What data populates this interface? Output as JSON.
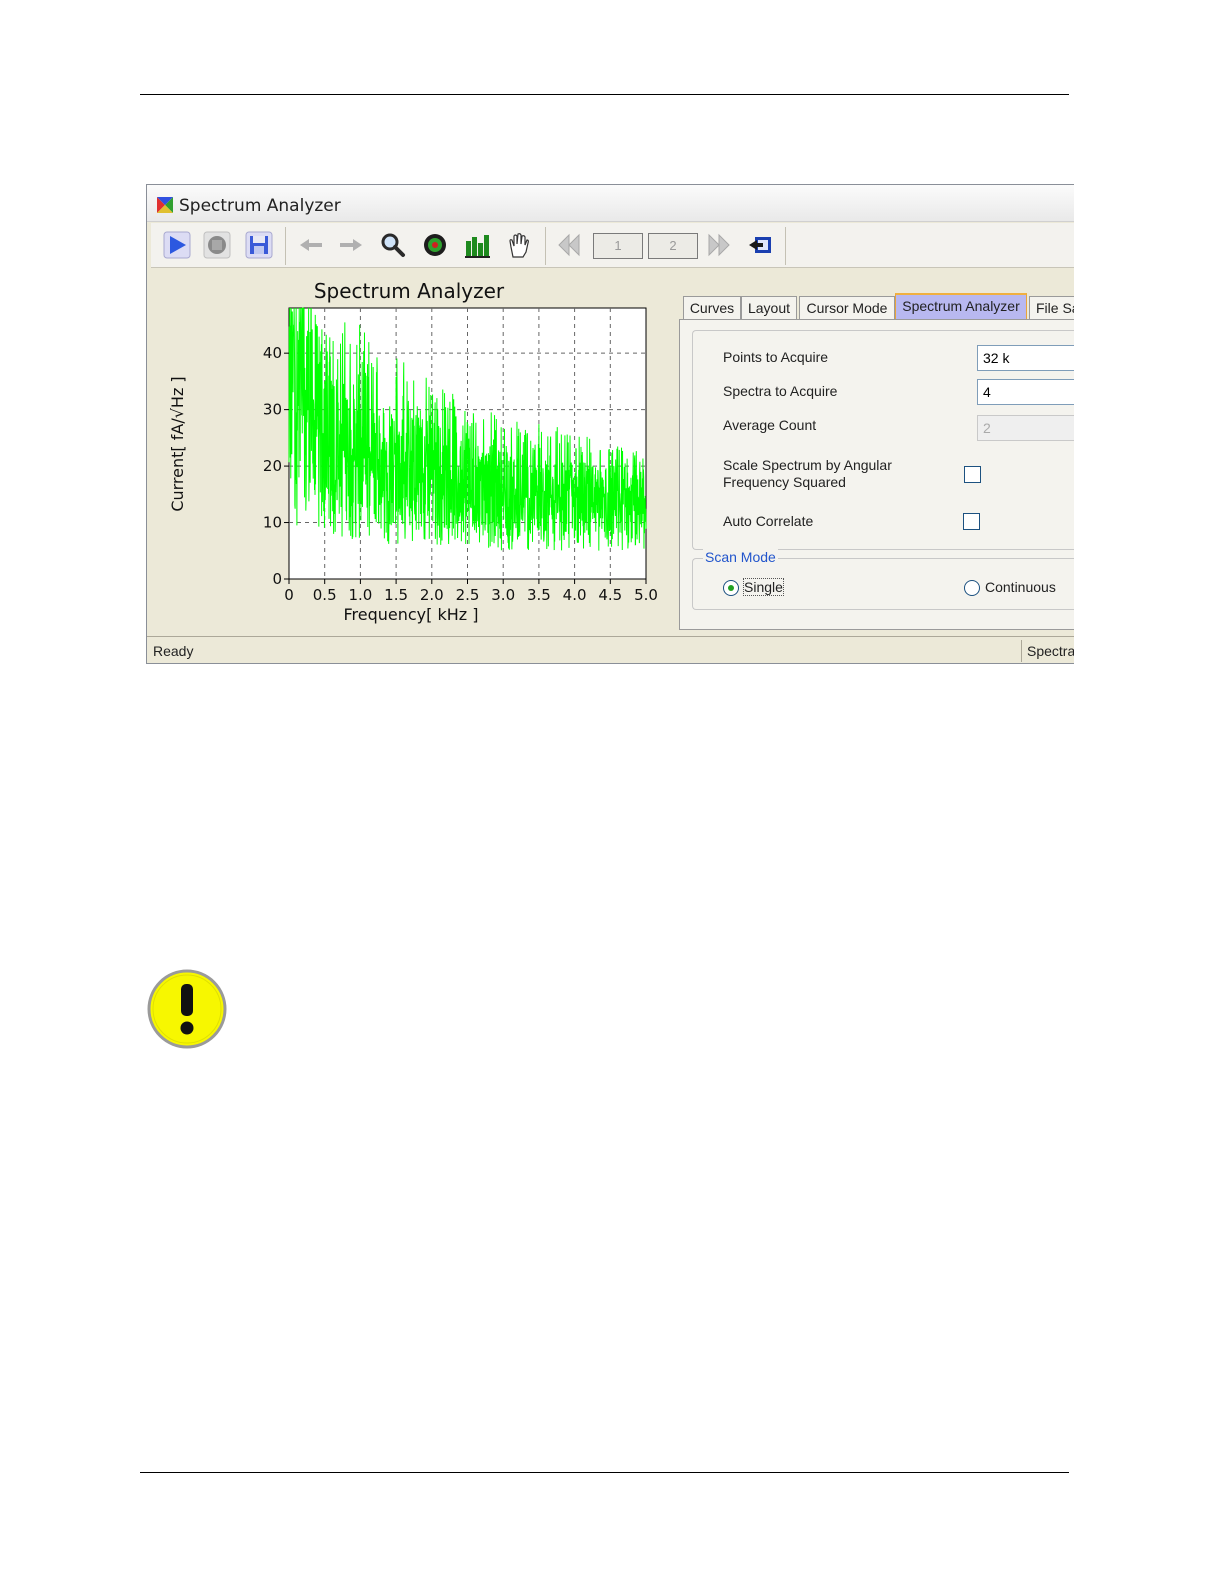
{
  "window": {
    "title": "Spectrum Analyzer",
    "toolbar": {
      "page_one": "1",
      "page_two": "2"
    },
    "tabs": [
      {
        "label": "Curves",
        "active": false
      },
      {
        "label": "Layout",
        "active": false
      },
      {
        "label": "Cursor Mode",
        "active": false
      },
      {
        "label": "Spectrum Analyzer",
        "active": true
      },
      {
        "label": "File Sa",
        "active": false
      }
    ],
    "settings": {
      "points_label": "Points to Acquire",
      "points_value": "32 k",
      "spectra_label": "Spectra to Acquire",
      "spectra_value": "4",
      "average_label": "Average Count",
      "average_value": "2",
      "scale_label_line1": "Scale Spectrum by Angular",
      "scale_label_line2": "Frequency Squared",
      "scale_checked": false,
      "autocorr_label": "Auto Correlate",
      "autocorr_checked": false
    },
    "scan_mode": {
      "legend": "Scan Mode",
      "single_label": "Single",
      "continuous_label": "Continuous",
      "selected": "Single"
    },
    "status": {
      "left": "Ready",
      "right": "Spectra"
    }
  },
  "chart_data": {
    "type": "line",
    "title": "Spectrum Analyzer",
    "xlabel": "Frequency[ kHz ]",
    "ylabel": "Current[ fA/√Hz ]",
    "xlim": [
      0,
      5.0
    ],
    "ylim": [
      0,
      48
    ],
    "xticks": [
      "0",
      "0.5",
      "1.0",
      "1.5",
      "2.0",
      "2.5",
      "3.0",
      "3.5",
      "4.0",
      "4.5",
      "5.0"
    ],
    "yticks": [
      "0",
      "10",
      "20",
      "30",
      "40"
    ],
    "grid": true,
    "series": [
      {
        "color": "#00ff00",
        "x": [
          0,
          0.5,
          1.0,
          1.5,
          2.0,
          2.5,
          3.0,
          3.5,
          4.0,
          4.5,
          5.0
        ],
        "y": [
          45,
          25,
          22,
          20,
          19,
          17,
          15,
          14,
          14,
          13,
          13
        ],
        "y_low": [
          10,
          7,
          7,
          6,
          6,
          6,
          5,
          5,
          5,
          5,
          5
        ],
        "y_high": [
          48,
          48,
          45,
          40,
          36,
          31,
          29,
          28,
          26,
          24,
          23
        ]
      }
    ]
  },
  "colors": {
    "series": "#00ff00",
    "active_tab": "#b8b8f0",
    "scan_mode_legend": "#2255cc"
  }
}
